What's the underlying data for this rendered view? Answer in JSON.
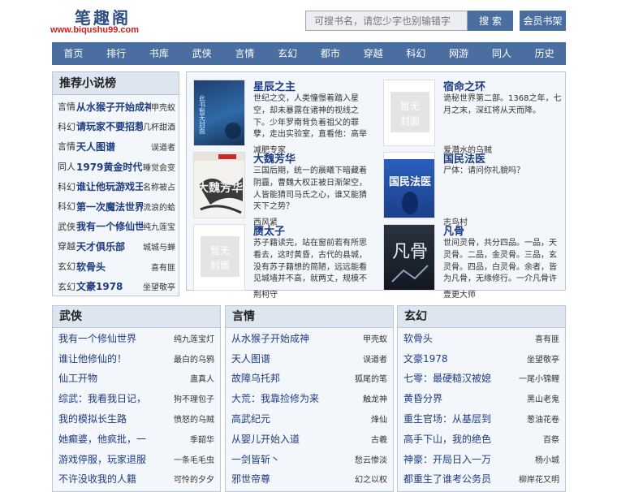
{
  "header": {
    "logo_title": "笔趣阁",
    "logo_url": "www.biqushu99.com",
    "search_placeholder": "可搜书名，请您少字也别输错字",
    "search_button": "搜 索",
    "shelf_button": "会员书架"
  },
  "nav": [
    "首页",
    "排行",
    "书库",
    "武侠",
    "言情",
    "玄幻",
    "都市",
    "穿越",
    "科幻",
    "网游",
    "同人",
    "历史"
  ],
  "recommend": {
    "title": "推荐小说榜",
    "items": [
      {
        "cat": "言情",
        "title": "从水猴子开始成神",
        "author": "甲壳蚁"
      },
      {
        "cat": "科幻",
        "title": "请玩家不要招惹软",
        "author": "几杯甜酒"
      },
      {
        "cat": "言情",
        "title": "天人图谱",
        "author": "误道者"
      },
      {
        "cat": "同人",
        "title": "1979黄金时代",
        "author": "睡觉会变"
      },
      {
        "cat": "科幻",
        "title": "谁让他玩游戏王",
        "author": "名称被占"
      },
      {
        "cat": "科幻",
        "title": "第一次魔法世界大",
        "author": "流浪的蛤"
      },
      {
        "cat": "武侠",
        "title": "我有一个修仙世界",
        "author": "纯九莲宝"
      },
      {
        "cat": "穿越",
        "title": "天才俱乐部",
        "author": "城城与蝉"
      },
      {
        "cat": "玄幻",
        "title": "软骨头",
        "author": "喜有匪"
      },
      {
        "cat": "玄幻",
        "title": "文豪1978",
        "author": "坐望敬亭"
      }
    ]
  },
  "featured": [
    {
      "title": "星辰之主",
      "desc": "世纪之交，人类憧憬着踏入星空，却未暴露在诸神的视线之下。少年罗南背负着祖父的罪孽，走出实验室，直看他：高举燃烧的笔记，脚",
      "author": "减肥专家",
      "cover": "dark-blue",
      "cover_text": "此书暂无封面"
    },
    {
      "title": "宿命之环",
      "desc": "诡秘世界第二部。1368之年，七月之末，深红将从天而降。",
      "author": "爱潜水的乌贼",
      "cover": "blank",
      "cover_text": "暂无封面"
    },
    {
      "title": "大魏芳华",
      "desc": "三国后期，统一的晨曦下暗藏着阴霾，曹魏大权正被日渐架空，人皆能猜司马氏之心，谁又能猜天下之势？",
      "author": "西风紧",
      "cover": "ink",
      "cover_text": "大魏芳华"
    },
    {
      "title": "国民法医",
      "desc": "尸体：请问你礼貌吗？",
      "author": "志鸟村",
      "cover": "blue",
      "cover_text": "国民法医"
    },
    {
      "title": "赝太子",
      "desc": "苏子籍读完，站在窗前若有所思看去，这时黄昏，古代的县城，没有苏子籍想的简陋，远远能看见城墙并不高，就两丈，规模不大，但",
      "author": "荆柯守",
      "cover": "blank",
      "cover_text": "暂无封面"
    },
    {
      "title": "凡骨",
      "desc": "世间灵骨，共分四品。一品，天灵骨。二品，金灵骨。三品，玄灵骨。四品，白灵骨。余者，皆为凡骨，无缘修行。一介凡骨许太平，誓要向这",
      "author": "壹更大师",
      "cover": "dark",
      "cover_text": "凡骨"
    }
  ],
  "columns": [
    {
      "title": "武侠",
      "items": [
        {
          "t": "我有一个修仙世界",
          "a": "纯九莲宝灯"
        },
        {
          "t": "谁让他修仙的！",
          "a": "最白的乌鸦"
        },
        {
          "t": "仙工开物",
          "a": "蛊真人"
        },
        {
          "t": "综武：我看我日记，",
          "a": "狗不理包子"
        },
        {
          "t": "我的模拟长生路",
          "a": "愤怒的乌贼"
        },
        {
          "t": "她癫婆，他疯批，一",
          "a": "季韶华"
        },
        {
          "t": "游戏停服，玩家退服",
          "a": "一条毛毛虫"
        },
        {
          "t": "不许没收我的人籍",
          "a": "可怜的夕夕"
        }
      ]
    },
    {
      "title": "言情",
      "items": [
        {
          "t": "从水猴子开始成神",
          "a": "甲壳蚁"
        },
        {
          "t": "天人图谱",
          "a": "误道者"
        },
        {
          "t": "故障乌托邦",
          "a": "狐尾的笔"
        },
        {
          "t": "大荒：我靠捡修为来",
          "a": "触龙神"
        },
        {
          "t": "高武纪元",
          "a": "烽仙"
        },
        {
          "t": "从婴儿开始入道",
          "a": "古羲"
        },
        {
          "t": "一剑皆斩丶",
          "a": "愁云惨淡"
        },
        {
          "t": "邪世帝尊",
          "a": "幻之以权"
        }
      ]
    },
    {
      "title": "玄幻",
      "items": [
        {
          "t": "软骨头",
          "a": "喜有匪"
        },
        {
          "t": "文豪1978",
          "a": "坐望敬亭"
        },
        {
          "t": "七零：最硬糙汉被媳",
          "a": "一尾小锦鲤"
        },
        {
          "t": "黄昏分界",
          "a": "黑山老鬼"
        },
        {
          "t": "重生官场：从基层到",
          "a": "葱油花卷"
        },
        {
          "t": "高手下山，我的绝色",
          "a": "百祭"
        },
        {
          "t": "神豪：开局日入一万",
          "a": "杨小城"
        },
        {
          "t": "都重生了谁考公务员",
          "a": "柳岸花又明"
        }
      ]
    }
  ]
}
